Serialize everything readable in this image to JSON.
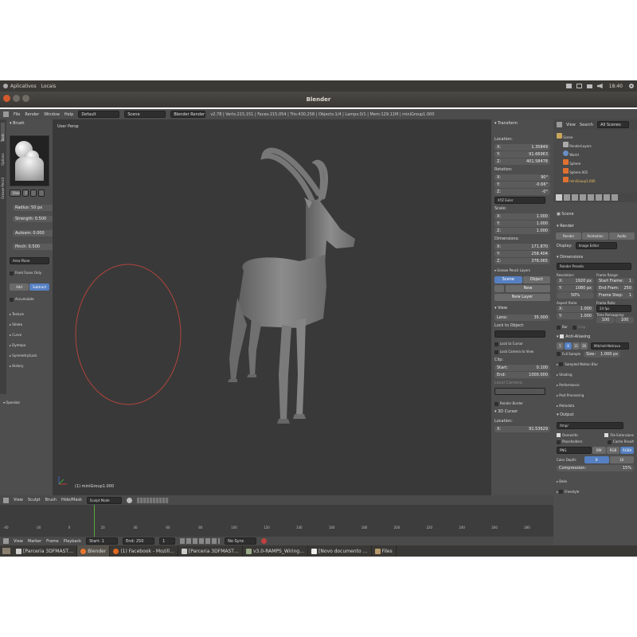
{
  "os_bar": {
    "menu1": "Aplicativos",
    "menu2": "Locais",
    "clock": "18:40"
  },
  "window": {
    "title": "Blender"
  },
  "info_bar": {
    "menus": [
      "File",
      "Render",
      "Window",
      "Help"
    ],
    "layout": "Default",
    "scene": "Scene",
    "engine": "Blender Render",
    "stats": "v2.78 | Verts:215,151 | Faces:215,054 | Tris:430,258 | Objects:1/4 | Lamps:0/1 | Mem:129.11M | miniGroup1.000"
  },
  "tool_shelf": {
    "tabs": [
      "Tools",
      "Options",
      "Grease Pencil"
    ],
    "brush_header": "Brush",
    "brush_name": "Blob",
    "brush_fake": "F",
    "radius": "Radius: 50 px",
    "strength": "Strength: 0.500",
    "autosmooth": "Autosm: 0.000",
    "pinch": "Pinch: 0.500",
    "stroke_method": "Area Plane",
    "front_faces": "Front Faces Only",
    "add": "Add",
    "subtract": "Subtract",
    "accumulate": "Accumulate",
    "sections": [
      "Texture",
      "Stroke",
      "Curve",
      "Dyntopo",
      "Symmetry/Lock",
      "History"
    ],
    "operator": "Operator"
  },
  "viewport": {
    "label": "User Persp",
    "object_label": "(1) miniGroup1.000"
  },
  "n_panel": {
    "transform": "Transform",
    "location": "Location:",
    "loc": [
      {
        "k": "X:",
        "v": "1.35849"
      },
      {
        "k": "Y:",
        "v": "91.66963"
      },
      {
        "k": "Z:",
        "v": "401.58478"
      }
    ],
    "rotation": "Rotation:",
    "rot": [
      {
        "k": "X:",
        "v": "90°"
      },
      {
        "k": "Y:",
        "v": "-0.66°"
      },
      {
        "k": "Z:",
        "v": "-0°"
      }
    ],
    "rot_mode": "XYZ Euler",
    "scale": "Scale:",
    "scl": [
      {
        "k": "X:",
        "v": "1.000"
      },
      {
        "k": "Y:",
        "v": "1.000"
      },
      {
        "k": "Z:",
        "v": "1.000"
      }
    ],
    "dimensions": "Dimensions:",
    "dim": [
      {
        "k": "X:",
        "v": "171.870"
      },
      {
        "k": "Y:",
        "v": "258.404"
      },
      {
        "k": "Z:",
        "v": "378.065"
      }
    ],
    "gp_layers": "Grease Pencil Layers",
    "scene_btn": "Scene",
    "object_btn": "Object",
    "new": "New",
    "new_layer": "New Layer",
    "view": "View",
    "lens": "Lens:",
    "lens_val": "35.000",
    "lock_to_object": "Lock to Object:",
    "lock_cursor": "Lock to Cursor",
    "lock_camera": "Lock Camera to View",
    "clip": "Clip:",
    "clip_start": "Start:",
    "clip_start_val": "0.100",
    "clip_end": "End:",
    "clip_end_val": "1000.000",
    "local_camera": "Local Camera:",
    "render_border": "Render Border",
    "cursor_3d": "3D Cursor",
    "cursor_location": "Location:",
    "cursor_x": "X:",
    "cursor_x_val": "91.53629"
  },
  "outliner": {
    "menus": [
      "View",
      "Search"
    ],
    "filter": "All Scenes",
    "items": [
      "Scene",
      "RenderLayers",
      "World",
      "Sphere",
      "Sphere.001",
      "miniGroup1.000"
    ]
  },
  "properties": {
    "breadcrumb": "Scene",
    "render": "Render",
    "render_btn": "Render",
    "animation_btn": "Animation",
    "audio_btn": "Audio",
    "display": "Display:",
    "display_val": "Image Editor",
    "dimensions": "Dimensions",
    "presets": "Render Presets",
    "resolution": "Resolution:",
    "res_x": "X:",
    "res_x_val": "1920 px",
    "res_y": "Y:",
    "res_y_val": "1080 px",
    "res_pct": "50%",
    "frame_range": "Frame Range:",
    "start_frame": "Start Frame:",
    "start_frame_val": "1",
    "end_frame": "End Fram:",
    "end_frame_val": "250",
    "frame_step": "Frame Step:",
    "frame_step_val": "1",
    "aspect": "Aspect Ratio:",
    "asp_x": "X:",
    "asp_x_val": "1.000",
    "asp_y": "Y:",
    "asp_y_val": "1.000",
    "frame_rate": "Frame Rate:",
    "fps": "24 fps",
    "time_remap": "Time Remapping:",
    "remap_old": "100",
    "remap_new": "100",
    "border": "Bor",
    "crop": "Crop",
    "anti_aliasing": "Anti-Aliasing",
    "aa_samples": [
      "5",
      "8",
      "11",
      "16"
    ],
    "aa_filter": "Mitchell-Netrava",
    "full_sample": "Full Sample",
    "aa_size": "Size:",
    "aa_size_val": "1.000 px",
    "collapsed": [
      "Sampled Motion Blur",
      "Shading",
      "Performance",
      "Post Processing",
      "Metadata"
    ],
    "output": "Output",
    "output_path": "/tmp/",
    "overwrite": "Overwrite",
    "file_ext": "File Extensions",
    "placeholders": "Placeholders",
    "cache": "Cache Result",
    "format": "PNG",
    "bw": "BW",
    "rgb": "RGB",
    "rgba": "RGBA",
    "color_depth": "Color Depth:",
    "depth8": "8",
    "depth16": "16",
    "compression": "Compression:",
    "compression_val": "15%",
    "bake": "Bake",
    "freestyle": "Freestyle"
  },
  "viewport_header": {
    "menus": [
      "View",
      "Sculpt",
      "Brush",
      "Hide/Mask"
    ],
    "mode": "Sculpt Mode"
  },
  "timeline": {
    "ticks": [
      "-40",
      "-20",
      "0",
      "20",
      "40",
      "60",
      "80",
      "100",
      "120",
      "140",
      "160",
      "180",
      "200",
      "220",
      "240",
      "260",
      "280"
    ],
    "current_frame": 1
  },
  "timeline_header": {
    "menus": [
      "View",
      "Marker",
      "Frame",
      "Playback"
    ],
    "start": "Start:",
    "start_val": "1",
    "end": "End:",
    "end_val": "250",
    "current": "1",
    "sync": "No Sync"
  },
  "taskbar": {
    "items": [
      "[Parceria 3DFMAST…",
      "Blender",
      "(1) Facebook - Mozill…",
      "[Parceria 3DFMAST…",
      "v3.0-RAMPS_Wiring…",
      "[Novo documento …",
      "Files"
    ]
  }
}
